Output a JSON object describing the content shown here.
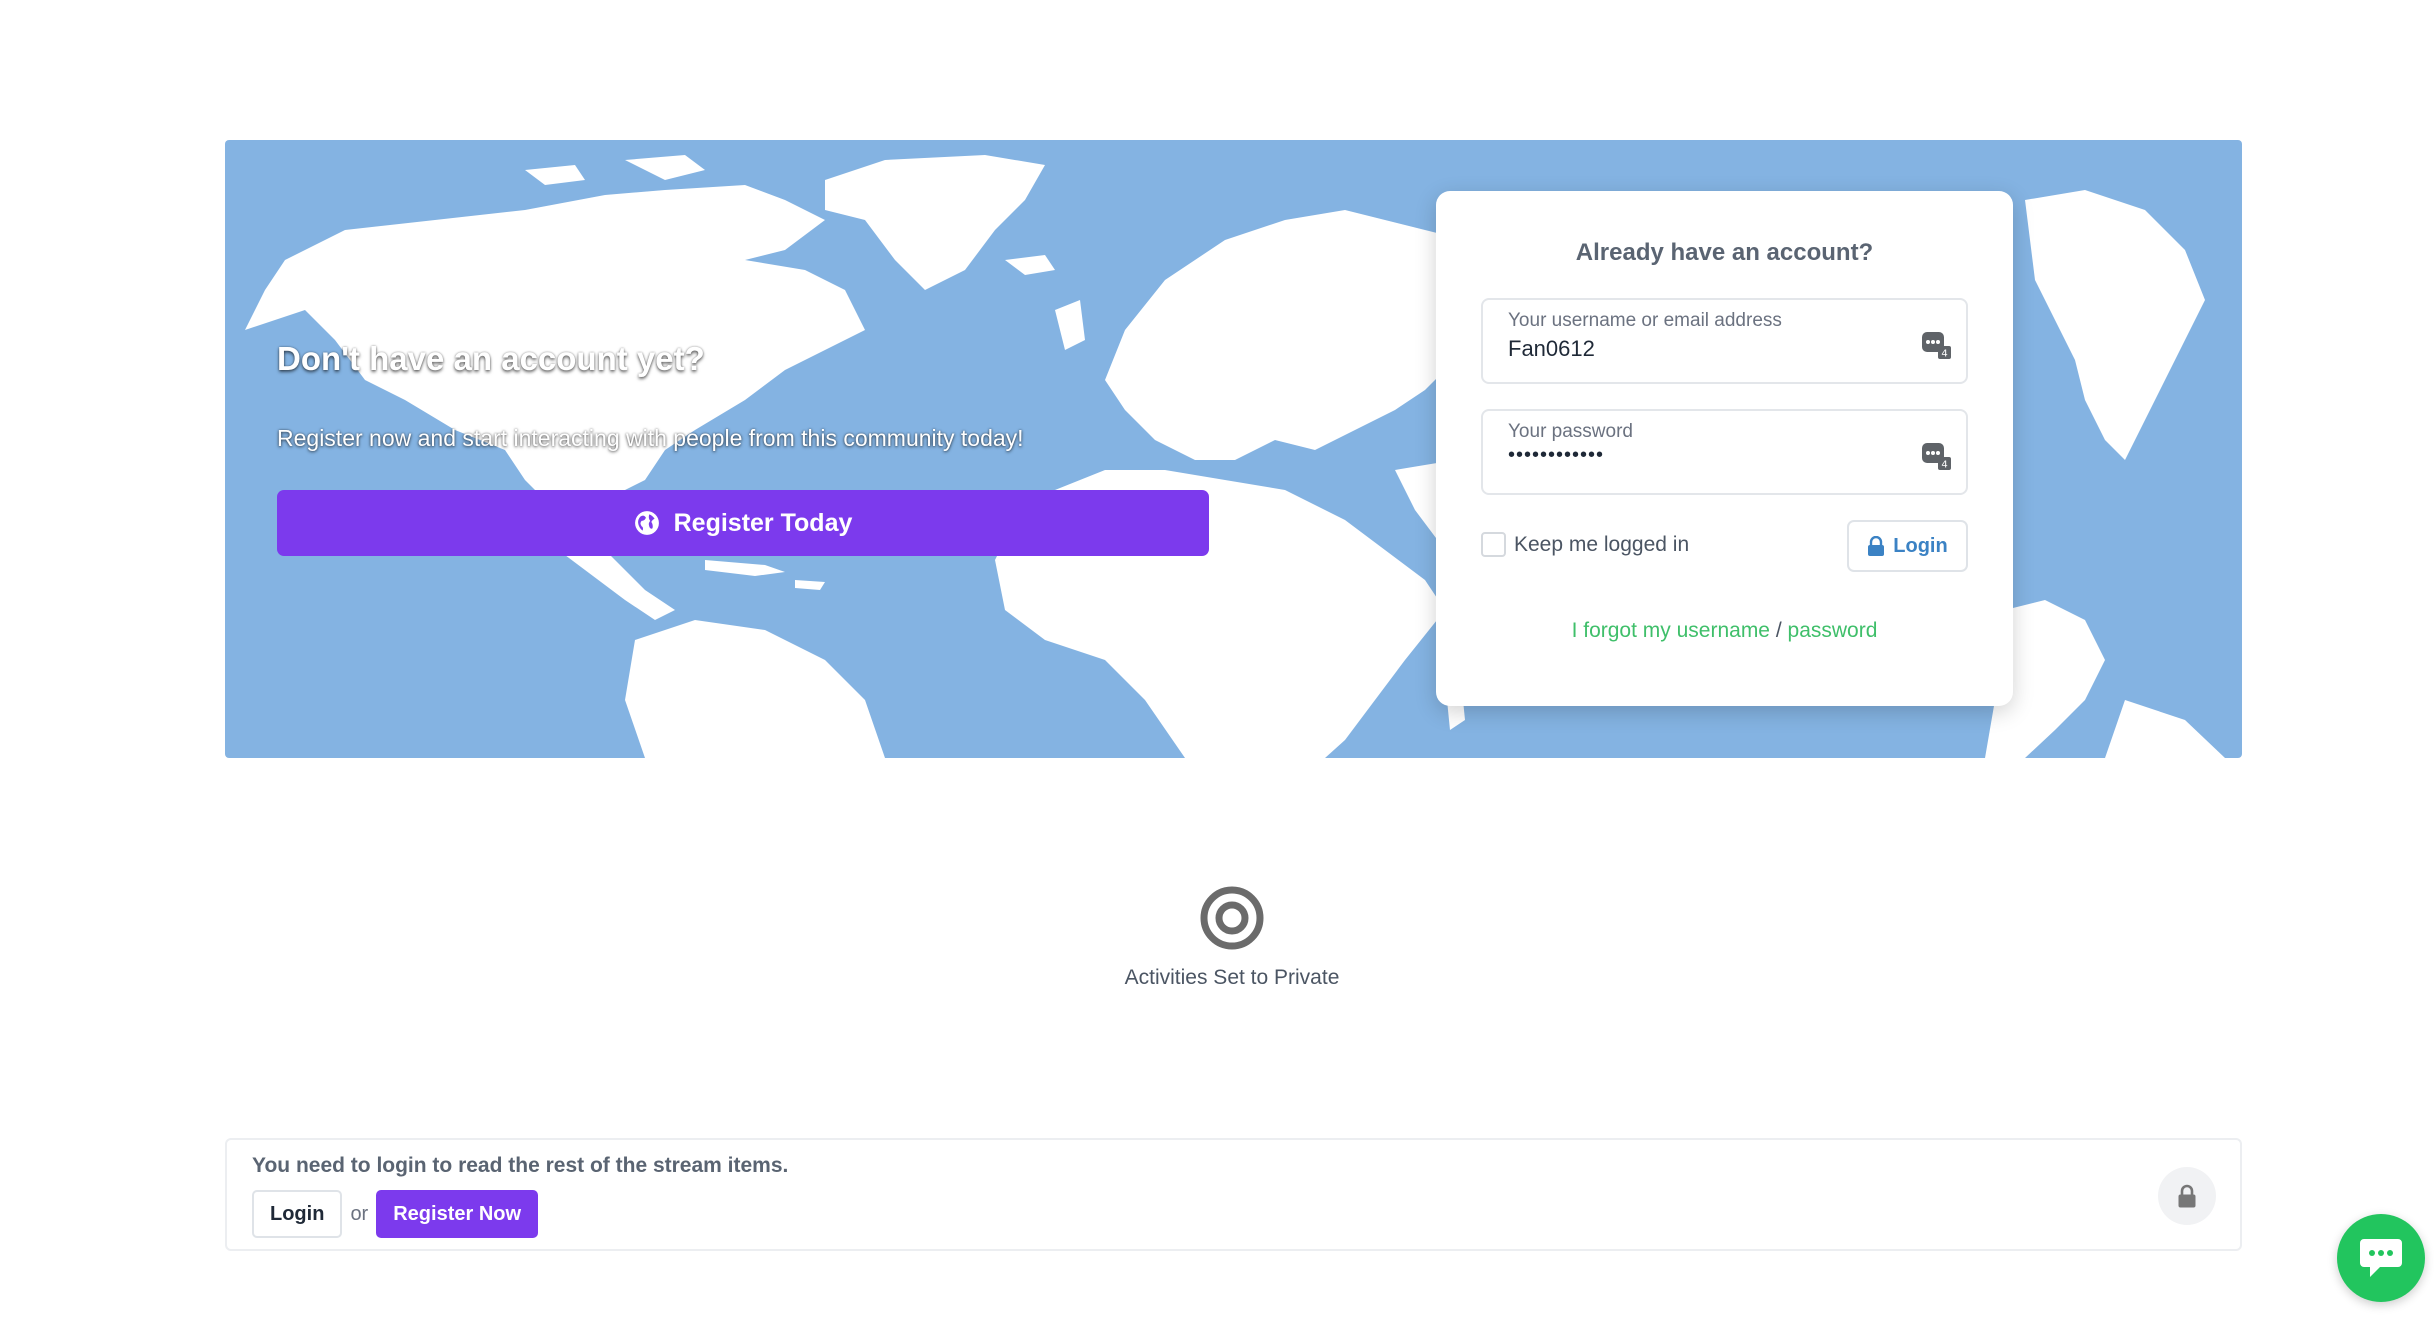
{
  "hero": {
    "title": "Don't have an account yet?",
    "subtitle": "Register now and start interacting with people from this community today!",
    "register_button_label": "Register Today",
    "register_icon": "globe-icon",
    "background_color": "#84b3e2"
  },
  "login_card": {
    "title": "Already have an account?",
    "username_label": "Your username or email address",
    "username_value": "Fan0612",
    "password_label": "Your password",
    "password_value": "••••••••••••",
    "password_manager_badge": "4",
    "remember_label": "Keep me logged in",
    "remember_checked": false,
    "login_button_label": "Login",
    "forgot_text_username": "I forgot my username",
    "forgot_separator": "/",
    "forgot_text_password": "password"
  },
  "activity": {
    "icon": "target-icon",
    "message": "Activities Set to Private"
  },
  "stream_bar": {
    "message": "You need to login to read the rest of the stream items.",
    "login_label": "Login",
    "or_text": "or",
    "register_label": "Register Now",
    "lock_icon": "lock-icon"
  },
  "chat": {
    "icon": "chat-bubble-icon"
  },
  "colors": {
    "primary_purple": "#7c3aed",
    "link_green": "#3fbf6a",
    "login_blue": "#3b82c4",
    "chat_green": "#22c55e"
  }
}
